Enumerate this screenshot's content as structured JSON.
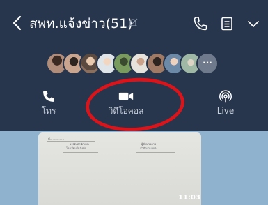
{
  "header": {
    "title": "สพท.แจ้งข่าว(51)"
  },
  "members": {
    "avatars": [
      {
        "color": "#b08c7a"
      },
      {
        "color": "#c9a58f"
      },
      {
        "color": "#8b6e5c"
      },
      {
        "color": "#dfe4e8"
      },
      {
        "color": "#7a9b5e"
      },
      {
        "color": "#e6e2dc"
      },
      {
        "color": "#a07a64"
      },
      {
        "color": "#6c8aa8"
      },
      {
        "color": "#9fb8a6"
      }
    ],
    "more_label": "···"
  },
  "actions": {
    "call_label": "โทร",
    "video_label": "วิดีโอคอล",
    "live_label": "Live"
  },
  "message": {
    "time": "11:03",
    "doc_lines": [
      "ที่................",
      "เรณิษสานักงาน",
      "ผู้อำนวยการ",
      "โรงเรียนในสังกัด",
      "สำนักงานเขต"
    ]
  },
  "colors": {
    "header_bg": "#27364c",
    "chat_bg": "#8fb3cf",
    "highlight": "#d9141b"
  }
}
